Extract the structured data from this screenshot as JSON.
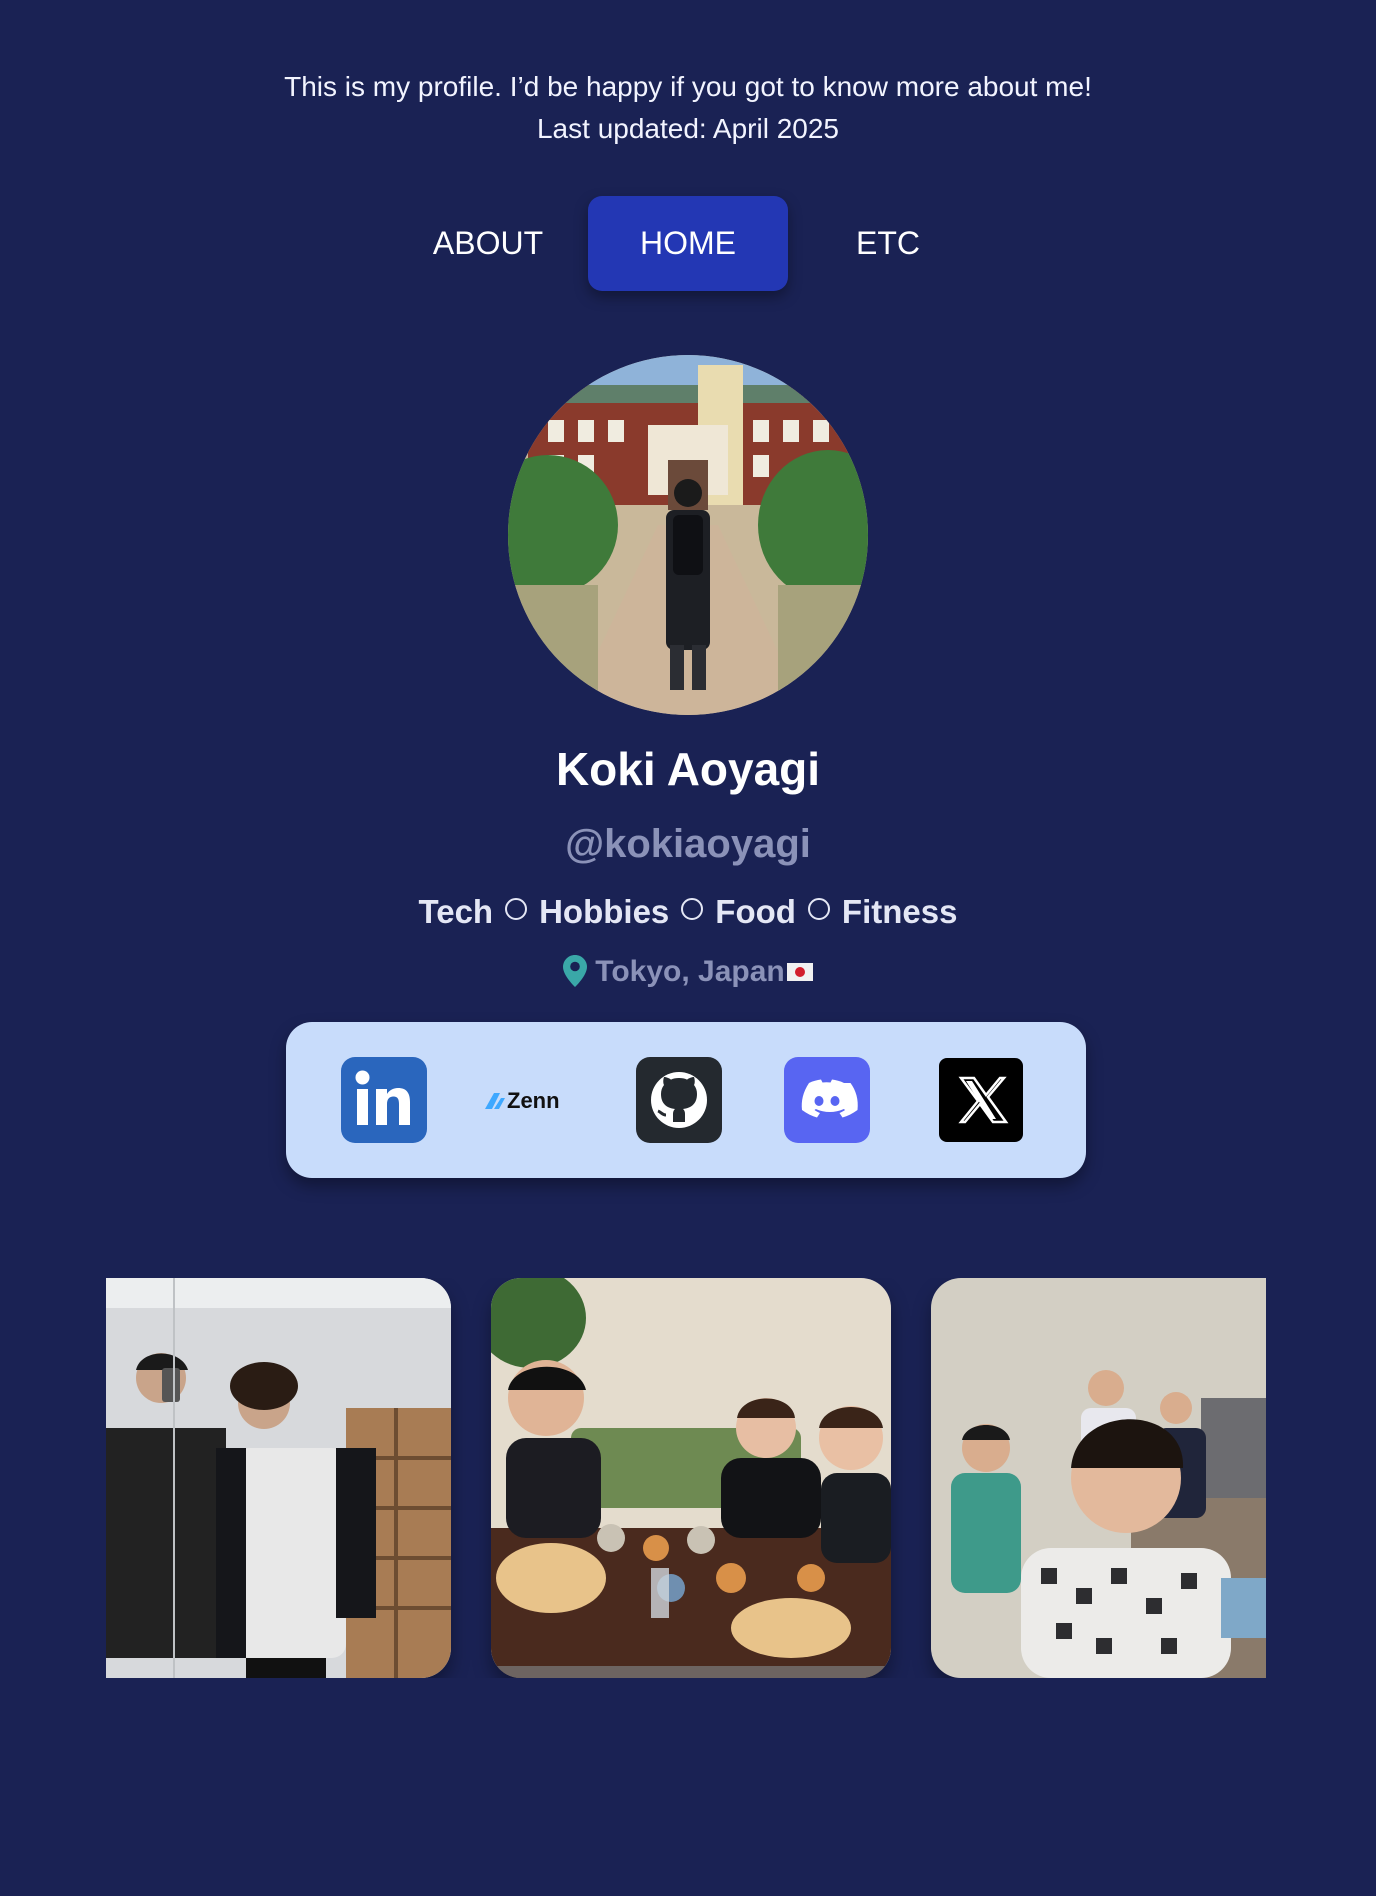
{
  "intro": {
    "line1": "This is my profile. I’d be happy if you got to know more about me!",
    "line2": "Last updated: April 2025"
  },
  "nav": {
    "tabs": [
      {
        "label": "ABOUT",
        "active": false
      },
      {
        "label": "HOME",
        "active": true
      },
      {
        "label": "ETC",
        "active": false
      }
    ]
  },
  "profile": {
    "name": "Koki Aoyagi",
    "handle": "@kokiaoyagi",
    "tags": [
      "Tech",
      "Hobbies",
      "Food",
      "Fitness"
    ],
    "location": "Tokyo, Japan",
    "location_icon": "map-pin-icon",
    "flag_icon": "japan-flag-icon"
  },
  "social": {
    "links": [
      {
        "icon": "linkedin-icon",
        "color": "#2a66bd"
      },
      {
        "icon": "zenn-logo",
        "label": "Zenn",
        "color": "#3ea8ff"
      },
      {
        "icon": "github-icon",
        "color": "#24292f"
      },
      {
        "icon": "discord-icon",
        "color": "#5865f2"
      },
      {
        "icon": "x-icon",
        "color": "#000000"
      }
    ]
  },
  "colors": {
    "background": "#1a2254",
    "accent": "#2337b4",
    "social_panel": "#c8dcfb",
    "muted_text": "#8b92b8"
  }
}
